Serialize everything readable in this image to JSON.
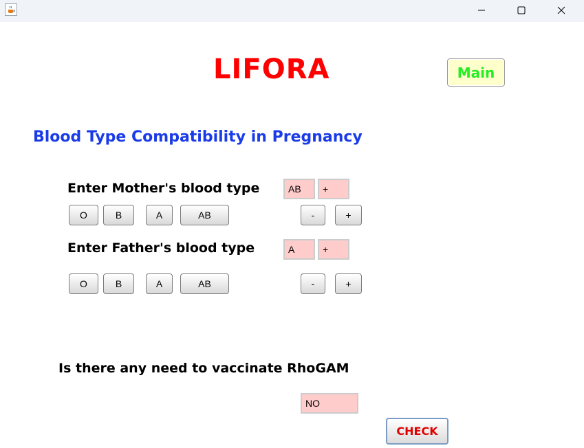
{
  "window": {
    "icon": "java-cup-icon",
    "controls": {
      "minimize": "—",
      "maximize": "☐",
      "close": "✕"
    }
  },
  "app": {
    "title": "LIFORA",
    "main_button": "Main",
    "subtitle": "Blood Type Compatibility in Pregnancy"
  },
  "mother": {
    "label": "Enter Mother's blood type",
    "abo_value": "AB",
    "rh_value": "+",
    "abo_buttons": [
      "O",
      "B",
      "A",
      "AB"
    ],
    "rh_buttons": [
      "-",
      "+"
    ]
  },
  "father": {
    "label": "Enter Father's blood type",
    "abo_value": "A",
    "rh_value": "+",
    "abo_buttons": [
      "O",
      "B",
      "A",
      "AB"
    ],
    "rh_buttons": [
      "-",
      "+"
    ]
  },
  "result": {
    "question": "Is there any need to vaccinate RhoGAM",
    "answer": "NO",
    "check_button": "CHECK"
  },
  "colors": {
    "title": "#ff0000",
    "subtitle": "#1a3be8",
    "main_button_text": "#22ee22",
    "main_button_bg": "#ffffcc",
    "field_bg": "#ffcccc",
    "check_text": "#e00000"
  }
}
